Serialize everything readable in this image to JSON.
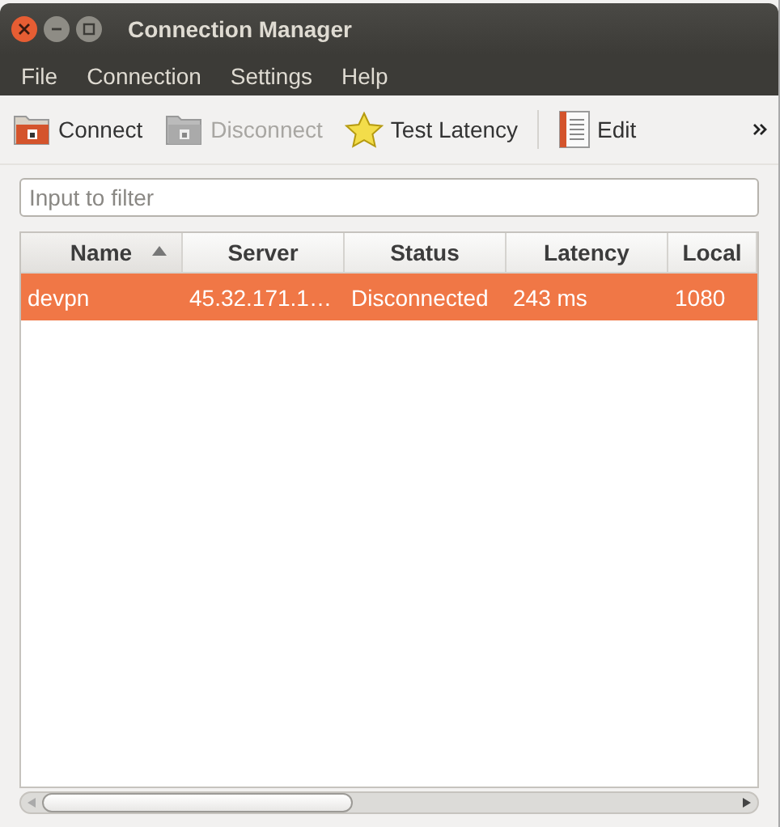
{
  "window": {
    "title": "Connection Manager"
  },
  "menu": [
    "File",
    "Connection",
    "Settings",
    "Help"
  ],
  "toolbar": [
    {
      "label": "Connect",
      "kind": "folder",
      "disabled": false
    },
    {
      "label": "Disconnect",
      "kind": "folder",
      "disabled": true
    },
    {
      "label": "Test Latency",
      "kind": "star",
      "disabled": false
    },
    {
      "label": "Edit",
      "kind": "document",
      "disabled": false
    }
  ],
  "filter": {
    "placeholder": "Input to filter"
  },
  "table": {
    "columns": [
      {
        "label": "Name",
        "sorted": true
      },
      {
        "label": "Server",
        "sorted": false
      },
      {
        "label": "Status",
        "sorted": false
      },
      {
        "label": "Latency",
        "sorted": false
      },
      {
        "label": "Local",
        "sorted": false
      }
    ],
    "rows": [
      {
        "cells": [
          "devpn",
          "45.32.171.1…",
          "Disconnected",
          "243 ms",
          "1080"
        ],
        "selected": true
      }
    ]
  }
}
